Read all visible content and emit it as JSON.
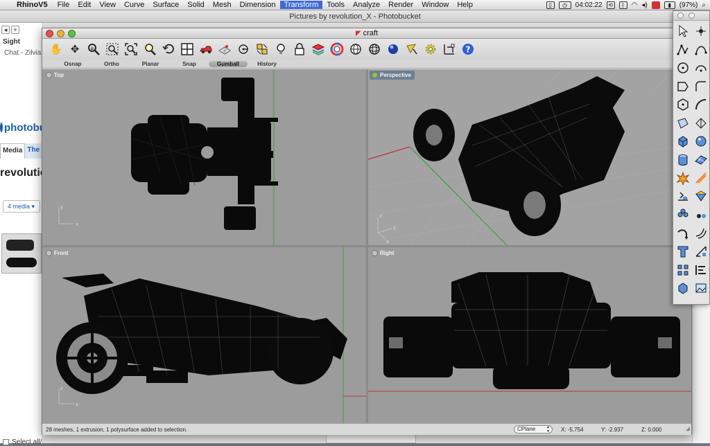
{
  "menubar": {
    "app": "RhinoV5",
    "items": [
      "File",
      "Edit",
      "View",
      "Curve",
      "Surface",
      "Solid",
      "Mesh",
      "Dimension",
      "Transform",
      "Tools",
      "Analyze",
      "Render",
      "Window",
      "Help"
    ],
    "active_item": "Transform",
    "time": "04:02:22",
    "battery": "(97%)"
  },
  "browser": {
    "title": "Pictures by revolution_X - Photobucket",
    "sidebar": {
      "bookmark": "Sight",
      "chat": "Chat - Zilvia",
      "logo": "photobuc",
      "tab_media": "Media",
      "tab_other": "The",
      "heading": "revolutio",
      "media_count": "4 media",
      "select_all": "Select all/"
    }
  },
  "rhino": {
    "title": "craft",
    "options": [
      "Osnap",
      "Ortho",
      "Planar",
      "Snap",
      "Gumball",
      "History"
    ],
    "active_option": "Gumball",
    "viewports": {
      "top": "Top",
      "perspective": "Perspective",
      "front": "Front",
      "right": "Right"
    },
    "axis": {
      "x": "x",
      "y": "y",
      "z": "z"
    },
    "status": {
      "message": "28 meshes, 1 extrusion, 1 polysurface added to selection.",
      "cplane": "CPlane",
      "x": "X: -5.754",
      "y": "Y: -2.937",
      "z": "Z: 0.000"
    },
    "toolbar_icons": [
      "pan-hand-icon",
      "rotate-view-icon",
      "zoom-icon",
      "zoom-window-icon",
      "zoom-extents-icon",
      "zoom-selected-icon",
      "undo-view-icon",
      "four-viewports-icon",
      "car-model-icon",
      "render-grid-icon",
      "cplane-icon",
      "osnap-icon",
      "light-bulb-icon",
      "lock-icon",
      "layers-icon",
      "color-wheel-icon",
      "sphere-wire-icon",
      "grid-sphere-icon",
      "render-ball-icon",
      "pen-highlight-icon",
      "gear-settings-icon",
      "dimension-icon",
      "help-icon"
    ],
    "palette_icons": [
      "select-arrow-icon",
      "point-icon",
      "polyline-icon",
      "curve-icon",
      "circle-icon",
      "arc-icon",
      "rectangle-icon",
      "fillet-curve-icon",
      "polygon-icon",
      "curve-tool-icon",
      "surface-corners-icon",
      "surface-tool-icon",
      "box-solid-icon",
      "sphere-solid-icon",
      "cylinder-solid-icon",
      "mesh-plane-icon",
      "explode-icon",
      "split-icon",
      "boolean-union-icon",
      "boolean-icon",
      "transform-move-icon",
      "gumball-icon",
      "fillet-edge-icon",
      "offset-icon",
      "text-icon",
      "dimension-tool-icon",
      "array-icon",
      "align-icon",
      "analyze-icon",
      "render-preview-icon"
    ]
  }
}
